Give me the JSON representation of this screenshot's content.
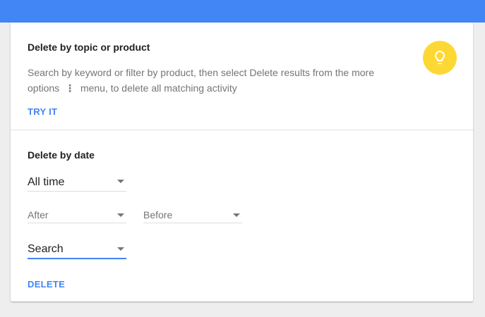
{
  "topic_section": {
    "title": "Delete by topic or product",
    "description_part1": "Search by keyword or filter by product, then select Delete results from the more options",
    "kebab_glyph": "⋮",
    "description_part2": "menu, to delete all matching activity",
    "action_label": "TRY IT"
  },
  "date_section": {
    "title": "Delete by date",
    "range_select": {
      "value": "All time"
    },
    "after_select": {
      "value": "After"
    },
    "before_select": {
      "value": "Before"
    },
    "product_select": {
      "value": "Search"
    },
    "action_label": "DELETE"
  },
  "colors": {
    "topbar": "#4285f4",
    "accent": "#4285f4",
    "bulb_bg": "#fdd835",
    "page_bg": "#eeeeee"
  },
  "icons": {
    "tip": "lightbulb-icon",
    "more_options": "more-vert-icon",
    "dropdown": "arrow-drop-down-icon"
  }
}
